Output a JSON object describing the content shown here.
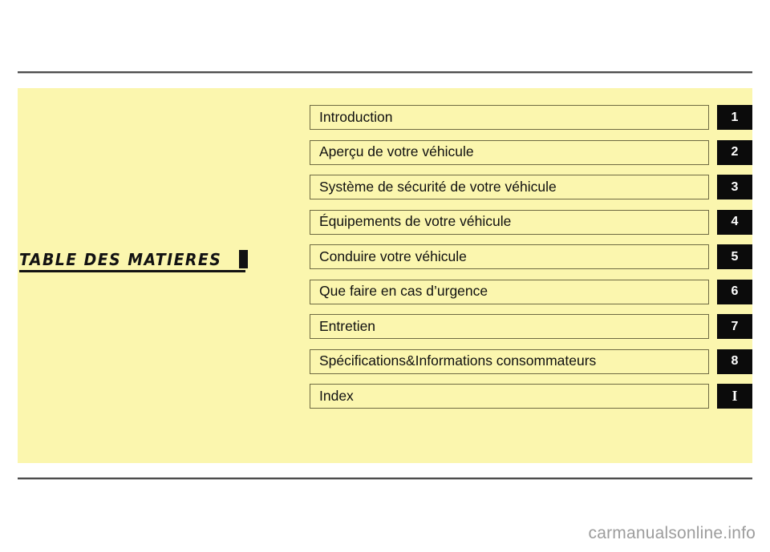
{
  "page": {
    "title": "TABLE  DES  MATIERES",
    "panel_color": "#fbf6ae",
    "tab_color": "#0b0b0b",
    "border_color": "#6e6a42"
  },
  "contents": {
    "entries": [
      {
        "label": "Introduction",
        "tab": "1",
        "tab_style": "sans"
      },
      {
        "label": "Aperçu de votre véhicule",
        "tab": "2",
        "tab_style": "sans"
      },
      {
        "label": "Système de sécurité de votre véhicule",
        "tab": "3",
        "tab_style": "sans"
      },
      {
        "label": "Équipements de votre véhicule",
        "tab": "4",
        "tab_style": "sans"
      },
      {
        "label": "Conduire votre véhicule",
        "tab": "5",
        "tab_style": "sans"
      },
      {
        "label": "Que faire en cas d’urgence",
        "tab": "6",
        "tab_style": "sans"
      },
      {
        "label": "Entretien",
        "tab": "7",
        "tab_style": "sans"
      },
      {
        "label": "Spécifications&Informations consommateurs",
        "tab": "8",
        "tab_style": "sans"
      },
      {
        "label": "Index",
        "tab": "I",
        "tab_style": "serif"
      }
    ]
  },
  "footer": {
    "watermark": "carmanualsonline.info"
  }
}
